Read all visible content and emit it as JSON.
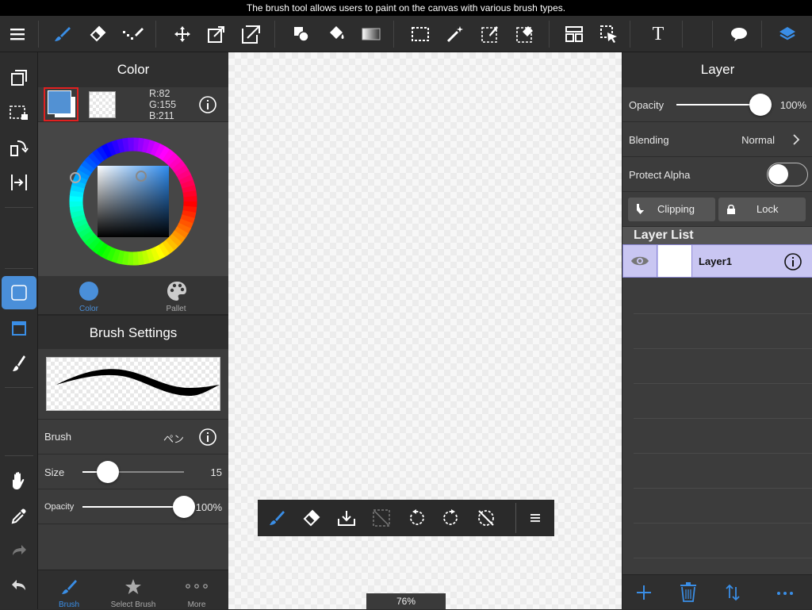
{
  "status_bar": {
    "text": "The brush tool allows users to paint on the canvas with various brush types."
  },
  "colors": {
    "accent": "#3a8ee6",
    "selected_primary": "#5291d3",
    "layer_selected": "#c9c6f2"
  },
  "toolbar": {
    "items": [
      "menu-icon",
      "brush-icon",
      "eraser-icon",
      "dot-brush-icon",
      "move-icon",
      "transform-icon",
      "export-icon",
      "shape-icon",
      "fill-bucket-icon",
      "gradient-icon",
      "select-rect-icon",
      "magic-wand-icon",
      "select-pen-icon",
      "select-eraser-icon",
      "layout-icon",
      "select-arrow-icon",
      "text-icon",
      "speech-bubble-icon",
      "layers-icon"
    ],
    "text_tool_label": "T"
  },
  "color_panel": {
    "title": "Color",
    "rgb": {
      "r": "R:82",
      "g": "G:155",
      "b": "B:211"
    },
    "tabs": {
      "color": "Color",
      "pallet": "Pallet"
    }
  },
  "brush_settings": {
    "title": "Brush Settings",
    "brush_label": "Brush",
    "brush_name": "ペン",
    "size_label": "Size",
    "size_value": "15",
    "size_fraction": 0.25,
    "opacity_label": "Opacity",
    "opacity_value": "100%",
    "opacity_fraction": 1.0
  },
  "left_bottom_tabs": {
    "brush": "Brush",
    "select_brush": "Select Brush",
    "more": "More"
  },
  "canvas": {
    "zoom": "76%"
  },
  "layer_panel": {
    "title": "Layer",
    "opacity_label": "Opacity",
    "opacity_value": "100%",
    "opacity_fraction": 1.0,
    "blending_label": "Blending",
    "blending_value": "Normal",
    "protect_alpha_label": "Protect Alpha",
    "protect_alpha_on": false,
    "clipping_label": "Clipping",
    "lock_label": "Lock",
    "layer_list_title": "Layer List",
    "layers": [
      {
        "name": "Layer1"
      }
    ]
  }
}
